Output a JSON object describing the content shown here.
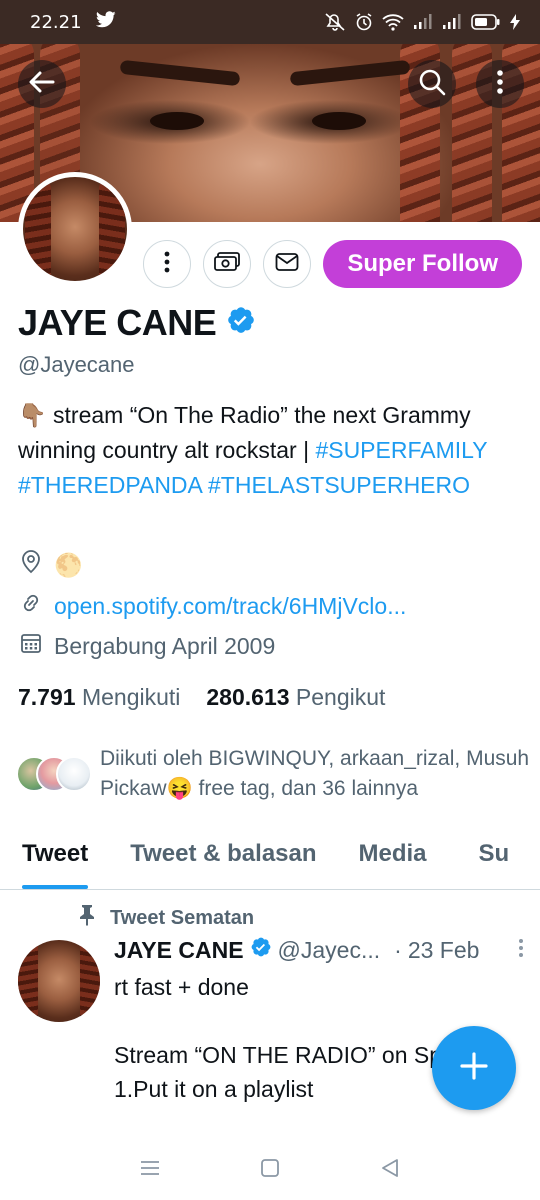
{
  "status_bar": {
    "time": "22.21",
    "icons": [
      "twitter-icon",
      "mute-icon",
      "alarm-icon",
      "wifi-icon",
      "signal-icon",
      "signal-icon",
      "battery-icon",
      "charging-icon"
    ]
  },
  "header": {
    "back_icon": "arrow-left-icon",
    "search_icon": "search-icon",
    "more_icon": "more-vertical-icon"
  },
  "profile": {
    "name": "JAYE CANE",
    "verified": true,
    "handle": "@Jayecane",
    "bio_emoji": "👇🏽",
    "bio_text": " stream “On The Radio” the next Grammy winning country alt rockstar | ",
    "bio_hashtags": "#SUPERFAMILY #THEREDPANDA #THELASTSUPERHERO",
    "location_emoji": "🌕",
    "website": "open.spotify.com/track/6HMjVclo...",
    "joined": "Bergabung April 2009",
    "following_count": "7.791",
    "following_label": "Mengikuti",
    "followers_count": "280.613",
    "followers_label": "Pengikut",
    "followed_by": "Diikuti oleh BIGWINQUY, arkaan_rizal, Musuh Pickaw😝 free tag, dan 36 lainnya"
  },
  "actions": {
    "more_icon": "more-vertical-icon",
    "tip_icon": "money-icon",
    "message_icon": "mail-icon",
    "super_follow_label": "Super Follow"
  },
  "tabs": [
    {
      "label": "Tweet",
      "active": true
    },
    {
      "label": "Tweet & balasan",
      "active": false
    },
    {
      "label": "Media",
      "active": false
    },
    {
      "label": "Su",
      "active": false
    }
  ],
  "tweet": {
    "pinned_label": "Tweet Sematan",
    "author_name": "JAYE CANE",
    "author_handle": "@Jayec...",
    "separator": "·",
    "date": "23 Feb",
    "text": "rt fast + done\n\nStream “ON THE RADIO” on Spotify!\n1.Put it on a playlist"
  },
  "colors": {
    "accent": "#1d9bf0",
    "super_follow": "#c33fd8",
    "text": "#0f1419",
    "secondary_text": "#536471"
  }
}
